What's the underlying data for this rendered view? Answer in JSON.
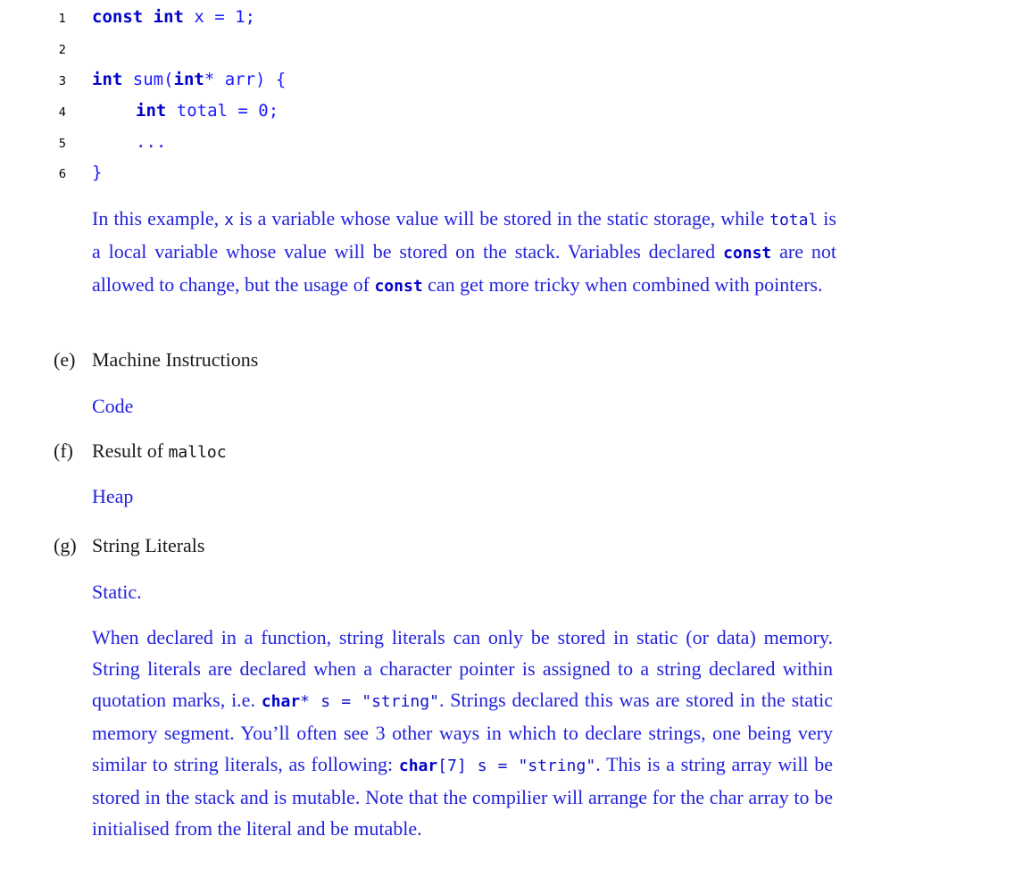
{
  "code_listing": {
    "lines": [
      {
        "num": "1",
        "kw1": "const",
        "kw2": "int",
        "rest": " x = 1;"
      },
      {
        "num": "2"
      },
      {
        "num": "3",
        "kw1": "int",
        "mid": " sum(",
        "kw2": "int",
        "rest": "* arr) {"
      },
      {
        "num": "4",
        "kw1": "int",
        "rest": " total = 0;"
      },
      {
        "num": "5",
        "rest": "..."
      },
      {
        "num": "6",
        "rest": "}"
      }
    ]
  },
  "explanation_d": {
    "t1": "In this example, ",
    "c1": "x",
    "t2": " is a variable whose value will be stored in the static storage, while ",
    "c2": "total",
    "t3": " is a local variable whose value will be stored on the stack. Variables declared ",
    "c3": "const",
    "t4": " are not allowed to change, but the usage of ",
    "c4": "const",
    "t5": " can get more tricky when combined with pointers."
  },
  "items": [
    {
      "label": "(e)",
      "text": "Machine Instructions",
      "answer": "Code"
    },
    {
      "label": "(f)",
      "text": "Result of ",
      "code": "malloc",
      "answer": "Heap"
    },
    {
      "label": "(g)",
      "text": "String Literals",
      "answer": "Static."
    }
  ],
  "explanation_g": {
    "t1": "When declared in a function, string literals can only be stored in static (or data) memory. String literals are declared when a character pointer is assigned to a string declared within quotation marks, i.e. ",
    "c1b": "char",
    "c1": "* s = \"string\"",
    "t2": ". Strings declared this was are stored in the static memory segment. You’ll often see 3 other ways in which to declare strings, one being very similar to string literals, as following: ",
    "c2b": "char",
    "c2": "[7] s = \"string\"",
    "t3": ". This is a string array will be stored in the stack and is mutable. Note that the compilier will arrange for the char array to be initialised from the literal and be mutable."
  }
}
